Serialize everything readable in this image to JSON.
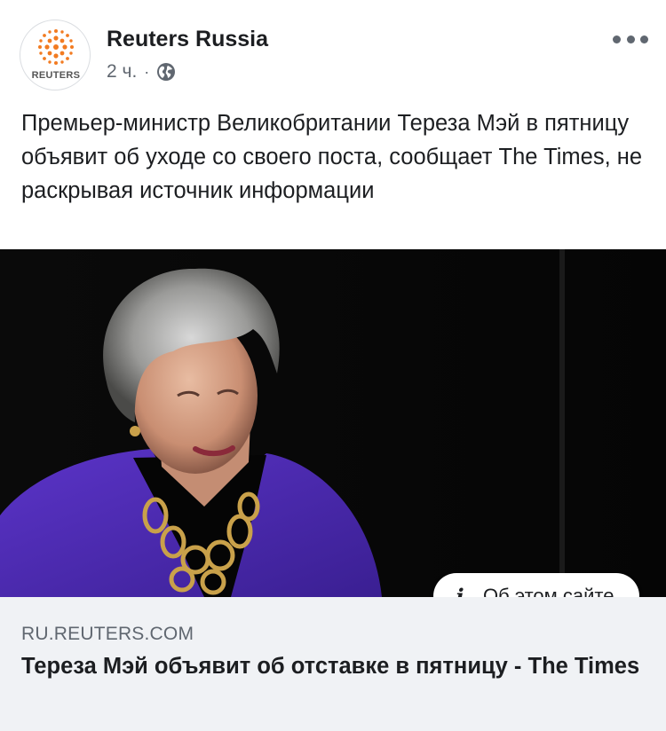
{
  "header": {
    "page_name": "Reuters Russia",
    "avatar_text": "REUTERS",
    "timestamp": "2 ч.",
    "separator": "·",
    "privacy_icon": "globe-icon",
    "more_icon": "more-options-icon"
  },
  "post": {
    "text": "Премьер-министр Великобритании Тереза Мэй в пятницу объявит об уходе со своего поста, сообщает The Times, не раскрывая источник информации"
  },
  "image": {
    "about_button_icon": "info-icon",
    "about_button_label": "Об этом сайте"
  },
  "link": {
    "domain": "RU.REUTERS.COM",
    "title": "Тереза Мэй объявит об отставке в пятницу - The Times"
  },
  "colors": {
    "brand_orange": "#f27b21",
    "text_primary": "#1c1e21",
    "text_secondary": "#606770",
    "preview_bg": "#f0f2f5"
  }
}
